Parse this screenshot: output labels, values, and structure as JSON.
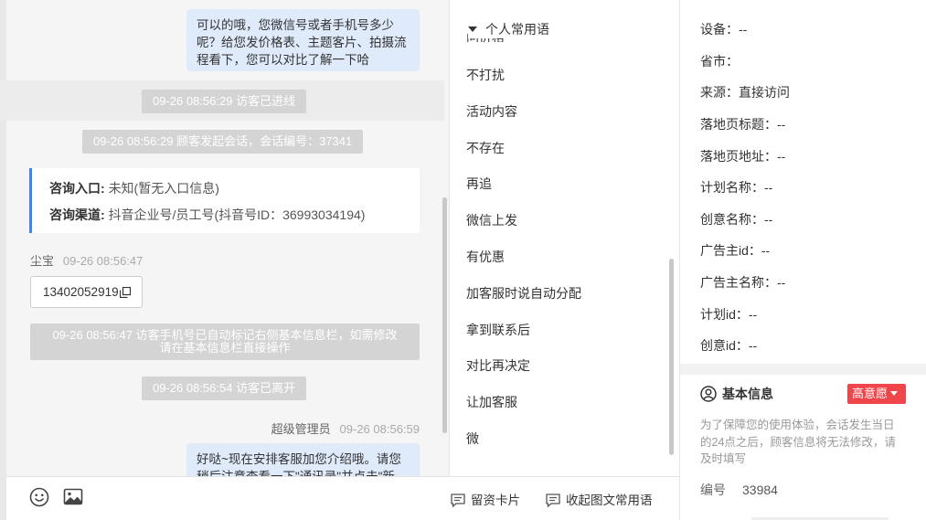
{
  "chat": {
    "msg_top": "可以的哦，您微信号或者手机号多少呢？给您发价格表、主题客片、拍摄流程看下，您可以对比了解一下哈",
    "sys_enter": "09-26 08:56:29 访客已进线",
    "sys_session": "09-26 08:56:29 顾客发起会话，会话编号：37341",
    "card": {
      "entry_label": "咨询入口:",
      "entry_value": "未知(暂无入口信息)",
      "channel_label": "咨询渠道:",
      "channel_value": "抖音企业号/员工号(抖音号ID：36993034194)"
    },
    "visitor_name": "尘宝",
    "visitor_time": "09-26 08:56:47",
    "visitor_phone": "13402052919",
    "sys_phone_line1": "09-26 08:56:47 访客手机号已自动标记右侧基本信息栏，如需修改",
    "sys_phone_line2": "请在基本信息栏直接操作",
    "sys_leave": "09-26 08:56:54 访客已离开",
    "agent_name": "超级管理员",
    "agent_time": "09-26 08:56:59",
    "msg_bottom": "好哒~现在安排客服加您介绍哦。请您稍后注意查看一下\"通讯录\"并点击\"新"
  },
  "toolbar": {
    "emoji_icon": "smile-icon",
    "image_icon": "image-icon",
    "leave_card": "留资卡片",
    "collapse_phrases": "收起图文常用语"
  },
  "phrases": {
    "header": "个人常用语",
    "cut_item": "问价格",
    "items": [
      "不打扰",
      "活动内容",
      "不存在",
      "再追",
      "微信上发",
      "有优惠",
      "加客服时说自动分配",
      "拿到联系后",
      "对比再决定",
      "让加客服",
      "微"
    ]
  },
  "info": {
    "device": "设备：--",
    "province": "省市：",
    "source": "来源：直接访问",
    "landing_title": "落地页标题：--",
    "landing_url": "落地页地址：--",
    "plan_name": "计划名称：--",
    "creative_name": "创意名称：--",
    "advertiser_id": "广告主id：--",
    "advertiser_name": "广告主名称：--",
    "plan_id": "计划id：--",
    "creative_id": "创意id：--",
    "basic_title": "基本信息",
    "intent": "高意愿",
    "note": "为了保障您的使用体验，会话发生当日的24点之后，顾客信息将无法修改，请及时填写",
    "id_label": "编号",
    "id_value": "33984"
  },
  "colors": {
    "accent": "#3c85ee",
    "out_bubble": "#dfeafa",
    "sys_bg": "#d4d4d4",
    "intent_red": "#f0454b"
  }
}
